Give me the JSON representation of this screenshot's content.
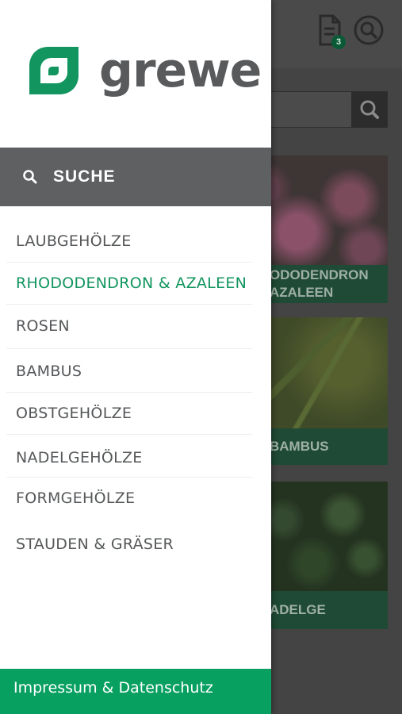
{
  "brand": {
    "name": "grewe"
  },
  "header": {
    "cart_count": "3"
  },
  "drawer": {
    "search_label": "SUCHE",
    "menu": [
      {
        "label": "LAUBGEHÖLZE",
        "active": false
      },
      {
        "label": "RHODODENDRON & AZALEEN",
        "active": true
      },
      {
        "label": "ROSEN",
        "active": false
      },
      {
        "label": "BAMBUS",
        "active": false
      },
      {
        "label": "OBSTGEHÖLZE",
        "active": false
      },
      {
        "label": "NADELGEHÖLZE",
        "active": false
      },
      {
        "label": "FORMGEHÖLZE",
        "active": false
      },
      {
        "label": "STAUDEN & GRÄSER",
        "active": false
      }
    ],
    "footer_label": "Impressum & Datenschutz"
  },
  "background_tiles": [
    {
      "label_line1": "ODODENDRON",
      "label_line2": "AZALEEN"
    },
    {
      "label": "BAMBUS"
    },
    {
      "label": "ADELGE"
    }
  ],
  "colors": {
    "brand_green": "#08a061",
    "active_green": "#12955f",
    "search_bar_gray": "#5e6062",
    "text_gray": "#555759"
  }
}
